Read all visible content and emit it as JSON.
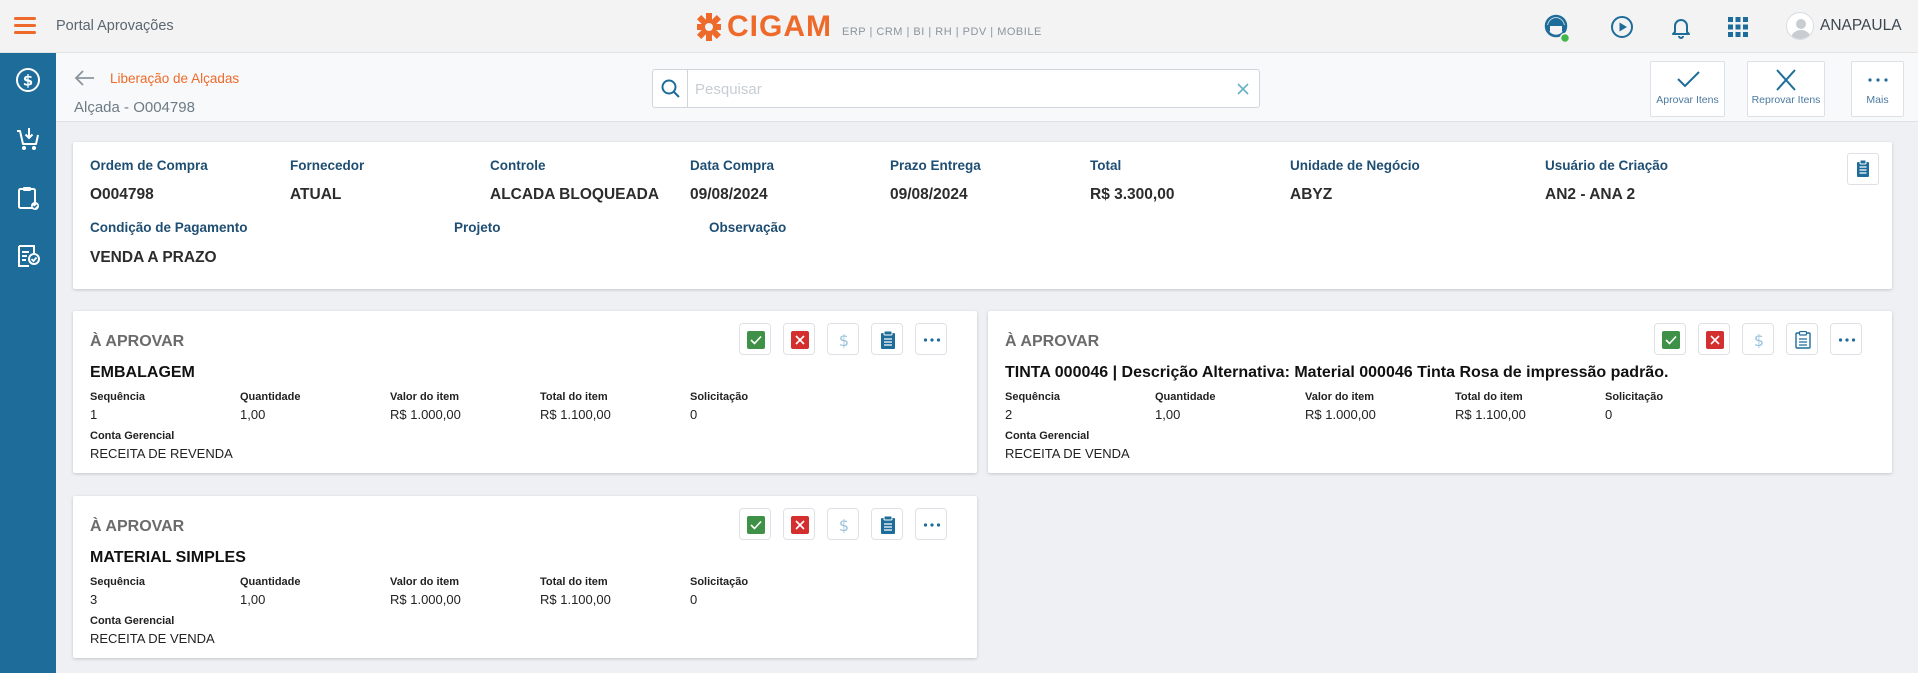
{
  "app": {
    "title": "Portal Aprovações",
    "brand": "CIGAM",
    "brand_tagline": "ERP | CRM | BI | RH | PDV | MOBILE",
    "user": "ANAPAULA"
  },
  "colors": {
    "accent": "#ee6a2a",
    "sidebar": "#1e6c9a",
    "approve": "#3e9146",
    "reject": "#d32f2f",
    "label": "#1f4e73"
  },
  "nav": {
    "back_link": "Liberação de Alçadas",
    "page_title": "Alçada - O004798"
  },
  "search": {
    "placeholder": "Pesquisar",
    "value": ""
  },
  "actions": {
    "approve": "Aprovar Itens",
    "reject": "Reprovar Itens",
    "more": "Mais"
  },
  "header": {
    "ordem_label": "Ordem de Compra",
    "ordem_value": "O004798",
    "fornecedor_label": "Fornecedor",
    "fornecedor_value": "ATUAL",
    "controle_label": "Controle",
    "controle_value": "ALCADA BLOQUEADA",
    "data_label": "Data Compra",
    "data_value": "09/08/2024",
    "prazo_label": "Prazo Entrega",
    "prazo_value": "09/08/2024",
    "total_label": "Total",
    "total_value": "R$ 3.300,00",
    "unidade_label": "Unidade de Negócio",
    "unidade_value": "ABYZ",
    "usuario_label": "Usuário de Criação",
    "usuario_value": "AN2 - ANA 2",
    "condicao_label": "Condição de Pagamento",
    "condicao_value": "VENDA A PRAZO",
    "projeto_label": "Projeto",
    "projeto_value": "",
    "observacao_label": "Observação",
    "observacao_value": ""
  },
  "field_labels": {
    "sequencia": "Sequência",
    "quantidade": "Quantidade",
    "valor": "Valor do item",
    "total": "Total do item",
    "solicitacao": "Solicitação",
    "conta": "Conta Gerencial"
  },
  "items": [
    {
      "status": "À APROVAR",
      "title": "EMBALAGEM",
      "sequencia": "1",
      "quantidade": "1,00",
      "valor": "R$ 1.000,00",
      "total": "R$ 1.100,00",
      "solicitacao": "0",
      "conta": "RECEITA DE REVENDA"
    },
    {
      "status": "À APROVAR",
      "title": "TINTA 000046 | Descrição Alternativa: Material 000046 Tinta Rosa de impressão padrão.",
      "sequencia": "2",
      "quantidade": "1,00",
      "valor": "R$ 1.000,00",
      "total": "R$ 1.100,00",
      "solicitacao": "0",
      "conta": "RECEITA DE VENDA"
    },
    {
      "status": "À APROVAR",
      "title": "MATERIAL SIMPLES",
      "sequencia": "3",
      "quantidade": "1,00",
      "valor": "R$ 1.000,00",
      "total": "R$ 1.100,00",
      "solicitacao": "0",
      "conta": "RECEITA DE VENDA"
    }
  ]
}
